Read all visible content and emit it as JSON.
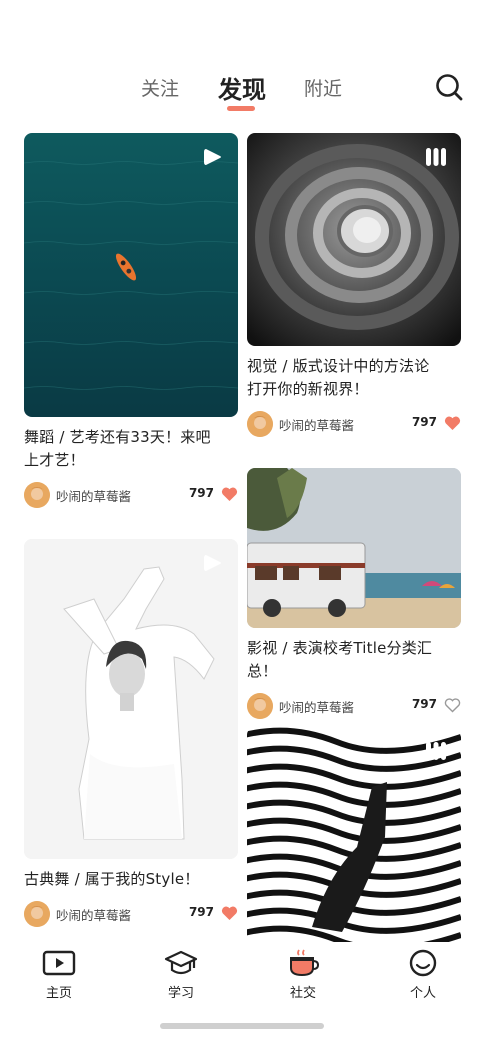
{
  "header": {
    "tabs": [
      {
        "label": "关注",
        "active": false
      },
      {
        "label": "发现",
        "active": true
      },
      {
        "label": "附近",
        "active": false
      }
    ],
    "search_icon": "search-icon",
    "accent_color": "#f27b66"
  },
  "cards": [
    {
      "title_line1": "舞蹈 / 艺考还有33天！来吧",
      "title_line2": "上才艺！",
      "author": "吵闹的草莓酱",
      "likes": "797",
      "liked": true,
      "badge": "play-icon"
    },
    {
      "title_line1": "视觉 / 版式设计中的方法论",
      "title_line2": "打开你的新视界！",
      "author": "吵闹的草莓酱",
      "likes": "797",
      "liked": true,
      "badge": "gallery-icon"
    },
    {
      "title_line1": "古典舞 / 属于我的Style！",
      "title_line2": "",
      "author": "吵闹的草莓酱",
      "likes": "797",
      "liked": true,
      "badge": "play-icon"
    },
    {
      "title_line1": "影视 / 表演校考Title分类汇总！",
      "title_line2": "",
      "author": "吵闹的草莓酱",
      "likes": "797",
      "liked": false,
      "badge": ""
    },
    {
      "title_line1": "",
      "title_line2": "",
      "author": "",
      "likes": "",
      "liked": false,
      "badge": "gallery-icon"
    }
  ],
  "bottom_nav": [
    {
      "label": "主页",
      "icon": "video-icon"
    },
    {
      "label": "学习",
      "icon": "graduation-cap-icon"
    },
    {
      "label": "社交",
      "icon": "coffee-cup-icon",
      "active": true
    },
    {
      "label": "个人",
      "icon": "smiley-icon"
    }
  ]
}
